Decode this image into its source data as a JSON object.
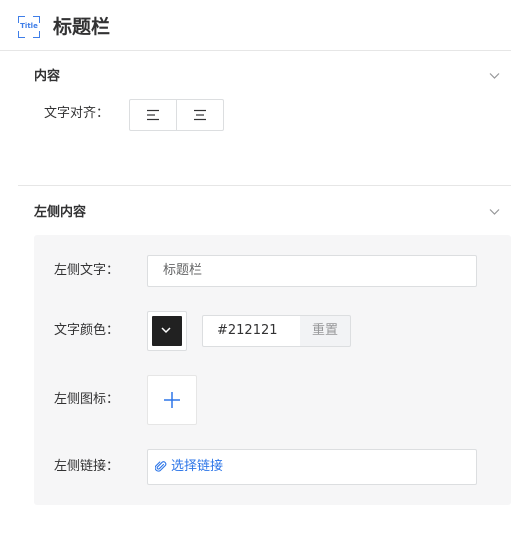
{
  "header": {
    "icon_text": "Title",
    "title": "标题栏"
  },
  "content_section": {
    "title": "内容",
    "align_label": "文字对齐："
  },
  "left_section": {
    "title": "左侧内容",
    "text_label": "左侧文字：",
    "text_value": "标题栏",
    "color_label": "文字颜色：",
    "color_value": "#212121",
    "reset_label": "重置",
    "icon_label": "左侧图标：",
    "link_label": "左侧链接：",
    "link_button": "选择链接"
  },
  "colors": {
    "accent": "#2d76e8",
    "swatch": "#212121"
  }
}
